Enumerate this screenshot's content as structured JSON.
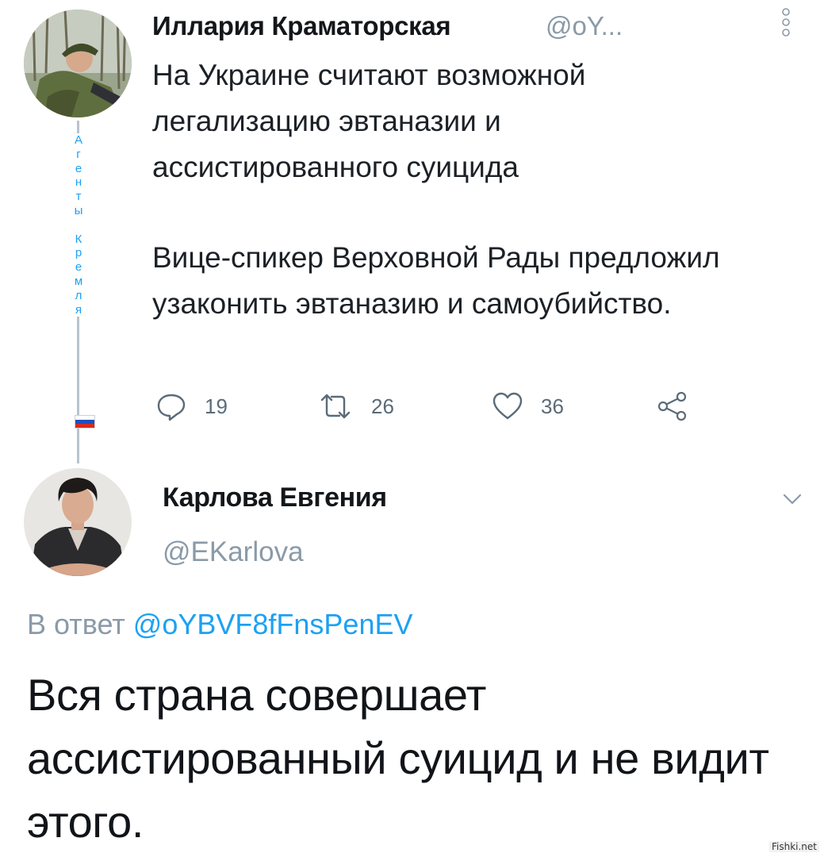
{
  "parent_tweet": {
    "display_name": "Иллария Краматорская",
    "handle": "@oY...",
    "vertical_label": [
      "А",
      "г",
      "е",
      "н",
      "т",
      "ы",
      " ",
      "К",
      "р",
      "е",
      "м",
      "л",
      "я"
    ],
    "text_paragraphs": [
      "На Украине считают возможной легализацию эвтаназии и ассистированного суицида",
      "Вице-спикер Верховной Рады предложил узаконить эвтаназию и самоубийство."
    ],
    "actions": {
      "reply_count": "19",
      "retweet_count": "26",
      "like_count": "36"
    },
    "icons": [
      "more-vertical-icon",
      "reply-icon",
      "retweet-icon",
      "like-heart-icon",
      "share-icon"
    ],
    "flag_colors": [
      "#ffffff",
      "#1f4fbf",
      "#d52b1e"
    ]
  },
  "reply_tweet": {
    "display_name": "Карлова Евгения",
    "handle": "@EKarlova",
    "reply_to_prefix": "В ответ",
    "reply_to_mention": "@oYBVF8fFnsPenEV",
    "text": "Вся страна совершает ассистированный суицид и не видит этого."
  },
  "watermark": "Fishki.net",
  "colors": {
    "link": "#1da1f2",
    "muted": "#8a9aa8",
    "text": "#14171a",
    "icon": "#5b6b78"
  }
}
